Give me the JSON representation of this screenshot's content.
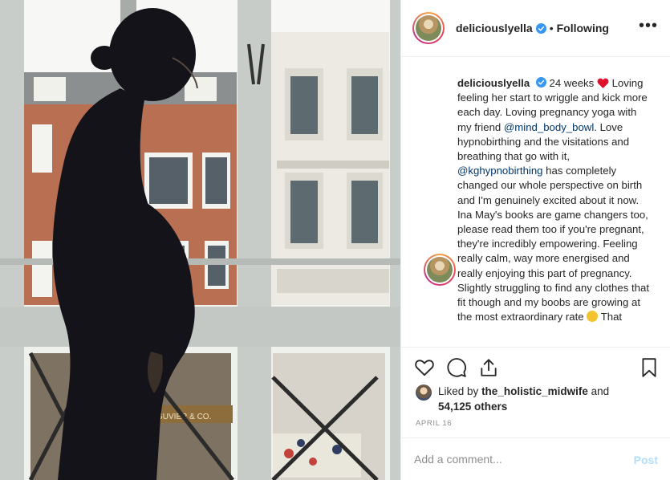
{
  "post": {
    "username": "deliciouslyella",
    "follow_status": "Following",
    "separator": "•",
    "more_glyph": "•••",
    "caption": {
      "username": "deliciouslyella",
      "segments": [
        {
          "type": "text",
          "value": "24 weeks"
        },
        {
          "type": "heart-emoji"
        },
        {
          "type": "text",
          "value": "Loving feeling her start to wriggle and kick more each day. Loving pregnancy yoga with my friend "
        },
        {
          "type": "mention",
          "value": "@mind_body_bowl"
        },
        {
          "type": "text",
          "value": ". Love hypnobirthing and the visitations and breathing that go with it, "
        },
        {
          "type": "mention",
          "value": "@kghypnobirthing"
        },
        {
          "type": "text",
          "value": " has completely changed our whole perspective on birth and I'm genuinely excited about it now. Ina May's books are game changers too, please read them too if you're pregnant, they're incredibly empowering. Feeling really calm, way more energised and really enjoying this part of pregnancy. Slightly struggling to find any clothes that fit though and my boobs are growing at the most extraordinary rate"
        },
        {
          "type": "smile-emoji"
        },
        {
          "type": "text",
          "value": "That"
        }
      ]
    },
    "likes": {
      "prefix": "Liked by",
      "user": "the_holistic_midwife",
      "joiner": "and",
      "others": "54,125 others"
    },
    "date": "APRIL 16",
    "comment_placeholder": "Add a comment...",
    "post_label": "Post",
    "photo": {
      "sign_text": "GUVIER & CO."
    }
  },
  "icons": {
    "verified": "verified-badge-icon",
    "heart": "heart-icon",
    "comment": "comment-bubble-icon",
    "share": "share-icon",
    "save": "bookmark-icon",
    "more": "more-options-icon"
  },
  "colors": {
    "mention": "#00376b",
    "verified": "#3897f0",
    "post_button": "#b2dffc",
    "heart_emoji": "#e0102b"
  }
}
